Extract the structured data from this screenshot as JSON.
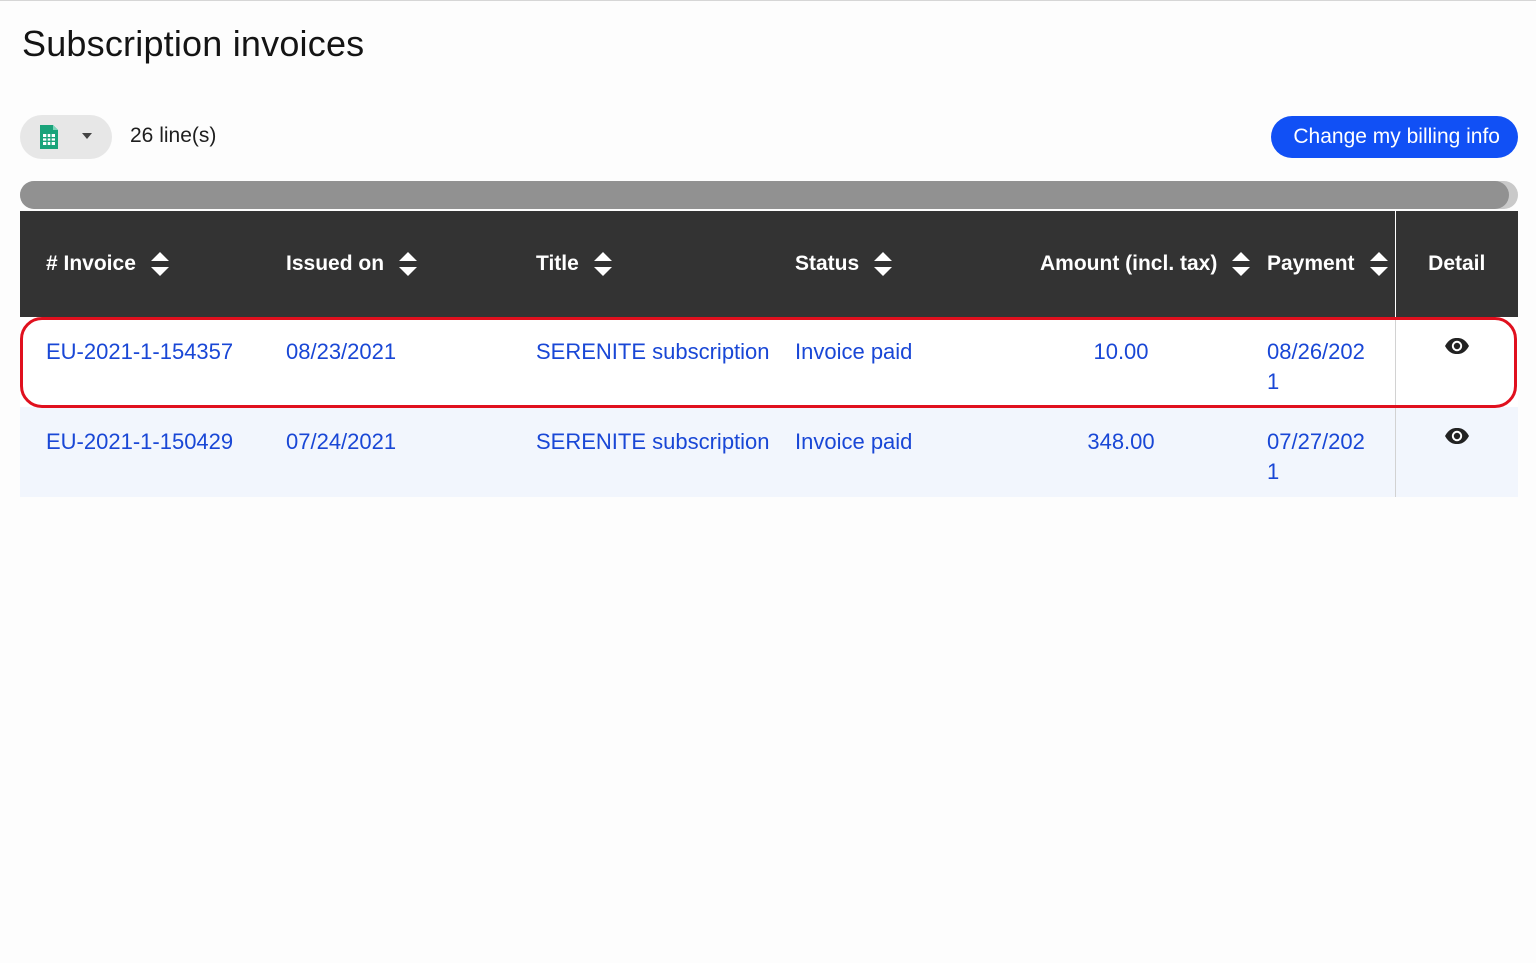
{
  "page": {
    "title": "Subscription invoices"
  },
  "toolbar": {
    "export_icon": "spreadsheet-icon",
    "caret_icon": "caret-down-icon",
    "line_count": "26 line(s)",
    "billing_button_label": "Change my billing info"
  },
  "table": {
    "columns": [
      {
        "label": "# Invoice",
        "sortable": true
      },
      {
        "label": "Issued on",
        "sortable": true
      },
      {
        "label": "Title",
        "sortable": true
      },
      {
        "label": "Status",
        "sortable": true
      },
      {
        "label": "Amount (incl. tax)",
        "sortable": true
      },
      {
        "label": "Payment",
        "sortable": true
      },
      {
        "label": "Detail",
        "sortable": false
      }
    ],
    "rows": [
      {
        "invoice": "EU-2021-1-154357",
        "issued_on": "08/23/2021",
        "title": "SERENITE subscription",
        "status": "Invoice paid",
        "amount": "10.00",
        "payment": "08/26/2021",
        "highlighted": true
      },
      {
        "invoice": "EU-2021-1-150429",
        "issued_on": "07/24/2021",
        "title": "SERENITE subscription",
        "status": "Invoice paid",
        "amount": "348.00",
        "payment": "07/27/2021",
        "highlighted": false
      }
    ]
  },
  "colors": {
    "primary": "#1150f5",
    "link": "#1947d6",
    "header_bg": "#333333",
    "highlight": "#e0101e",
    "export_icon": "#1aa37a"
  }
}
